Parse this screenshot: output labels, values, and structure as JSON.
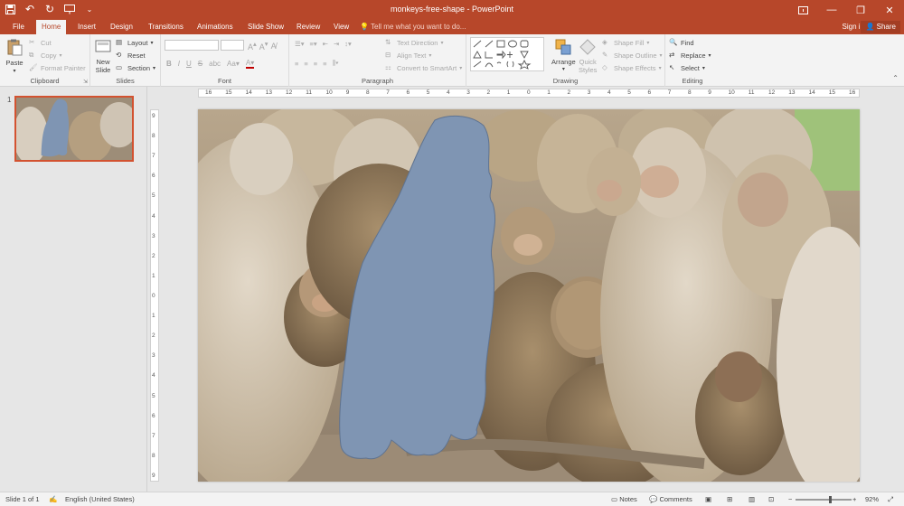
{
  "window": {
    "title": "monkeys-free-shape - PowerPoint"
  },
  "qat": {
    "save_icon": "save-icon",
    "undo_icon": "undo-icon",
    "redo_icon": "redo-icon",
    "present_icon": "start-slideshow-icon",
    "customize_icon": "customize-qat-icon"
  },
  "tabs": [
    {
      "label": "File"
    },
    {
      "label": "Home",
      "active": true
    },
    {
      "label": "Insert"
    },
    {
      "label": "Design"
    },
    {
      "label": "Transitions"
    },
    {
      "label": "Animations"
    },
    {
      "label": "Slide Show"
    },
    {
      "label": "Review"
    },
    {
      "label": "View"
    }
  ],
  "tell_me": "Tell me what you want to do...",
  "account": {
    "signin": "Sign in",
    "share": "Share"
  },
  "ribbon": {
    "clipboard": {
      "label": "Clipboard",
      "paste": "Paste",
      "cut": "Cut",
      "copy": "Copy",
      "format_painter": "Format Painter"
    },
    "slides": {
      "label": "Slides",
      "new_slide": "New",
      "new_slide2": "Slide",
      "layout": "Layout",
      "reset": "Reset",
      "section": "Section"
    },
    "font": {
      "label": "Font",
      "font_name": "",
      "font_size": ""
    },
    "paragraph": {
      "label": "Paragraph",
      "text_direction": "Text Direction",
      "align_text": "Align Text",
      "convert_smartart": "Convert to SmartArt"
    },
    "drawing": {
      "label": "Drawing",
      "arrange": "Arrange",
      "quick_styles": "Quick",
      "quick_styles2": "Styles",
      "shape_fill": "Shape Fill",
      "shape_outline": "Shape Outline",
      "shape_effects": "Shape Effects"
    },
    "editing": {
      "label": "Editing",
      "find": "Find",
      "replace": "Replace",
      "select": "Select"
    }
  },
  "thumbnails": [
    {
      "number": "1"
    }
  ],
  "rulers": {
    "horizontal": [
      "16",
      "15",
      "14",
      "13",
      "12",
      "11",
      "10",
      "9",
      "8",
      "7",
      "6",
      "5",
      "4",
      "3",
      "2",
      "1",
      "0",
      "1",
      "2",
      "3",
      "4",
      "5",
      "6",
      "7",
      "8",
      "9",
      "10",
      "11",
      "12",
      "13",
      "14",
      "15",
      "16"
    ],
    "vertical": [
      "9",
      "8",
      "7",
      "6",
      "5",
      "4",
      "3",
      "2",
      "1",
      "0",
      "1",
      "2",
      "3",
      "4",
      "5",
      "6",
      "7",
      "8",
      "9"
    ]
  },
  "status": {
    "slide": "Slide 1 of 1",
    "language": "English (United States)",
    "notes": "Notes",
    "comments": "Comments",
    "zoom": "92%",
    "zoom_level": 0.62
  },
  "colors": {
    "accent": "#b7472a",
    "shape_fill": "#7f95b3",
    "shape_outline": "#5f7390"
  }
}
